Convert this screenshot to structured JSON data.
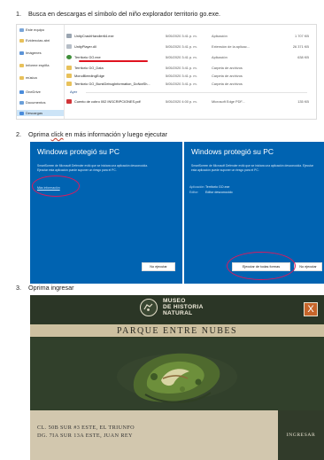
{
  "steps": [
    {
      "num": "1.",
      "text": "Busca en descargas el símbolo del niño explorador territorio go.exe."
    },
    {
      "num": "2.",
      "text_before": "Oprima ",
      "text_wavy": "click",
      "text_after": " en más información y luego ejecutar"
    },
    {
      "num": "3.",
      "text": "Oprima ingresar"
    }
  ],
  "explorer": {
    "nav": [
      {
        "label": "Este equipo",
        "color": "#7aa6d8"
      },
      {
        "label": "Evidencias abri",
        "color": "#e8c15a"
      },
      {
        "label": "Imágenes",
        "color": "#5c93d6"
      },
      {
        "label": "Informe espiña",
        "color": "#e8c15a"
      },
      {
        "label": "música",
        "color": "#e8c15a"
      },
      {
        "label": "OneDrive",
        "color": "#4a8cdb"
      },
      {
        "label": "Documentos",
        "color": "#6b9fd8"
      },
      {
        "label": "Descargas",
        "color": "#4a8cdb"
      }
    ],
    "files": [
      {
        "name": "UnityCrashHandler64.exe",
        "date": "5/05/2020 3:41 p. m.",
        "type": "Aplicación",
        "size": "1 707 KB",
        "color": "#9aa5b1"
      },
      {
        "name": "UnityPlayer.dll",
        "date": "5/05/2020 3:41 p. m.",
        "type": "Extensión de la aplicac...",
        "size": "26 371 KB",
        "color": "#b6bec7"
      },
      {
        "name": "Territorio GO.exe",
        "date": "5/05/2020 3:41 p. m.",
        "type": "Aplicación",
        "size": "638 KB",
        "color": "#3f8f3a"
      },
      {
        "name": "Territorio GO_Data",
        "date": "5/05/2020 3:41 p. m.",
        "type": "Carpeta de archivos",
        "size": "",
        "color": "#e8c15a"
      },
      {
        "name": "MonoBleedingEdge",
        "date": "5/05/2020 3:41 p. m.",
        "type": "Carpeta de archivos",
        "size": "",
        "color": "#e8c15a"
      },
      {
        "name": "Territorio GO_BurstDebugInformation_DoNotSh...",
        "date": "5/05/2020 3:41 p. m.",
        "type": "Carpeta de archivos",
        "size": "",
        "color": "#e8c15a"
      },
      {
        "name": "Cuento de cobro 002 INSCRIPCIONES.pdf",
        "date": "5/05/2020 4:00 p. m.",
        "type": "Microsoft Edge PDF...",
        "size": "135 KB",
        "color": "#d13438"
      }
    ],
    "group_label": "Ayer"
  },
  "smartscreen_left": {
    "title": "Windows protegió su PC",
    "body": "SmartScreen de Microsoft Defender evitó que se iniciara una aplicación desconocida. Ejecutar esta aplicación puede suponer un riesgo para el PC.",
    "link": "Más información",
    "button": "No ejecutar"
  },
  "smartscreen_right": {
    "title": "Windows protegió su PC",
    "body": "SmartScreen de Microsoft Defender evitó que se iniciara una aplicación desconocida. Ejecutar esta aplicación puede suponer un riesgo para el PC.",
    "app_label": "Aplicación:",
    "app_value": "Territorio GO.exe",
    "publisher_label": "Editor:",
    "publisher_value": "Editor desconocido",
    "run_button": "Ejecutar de todas formas",
    "cancel_button": "No ejecutar"
  },
  "museum": {
    "logo_lines": [
      "MUSEO",
      "DE HISTORIA",
      "NATURAL"
    ],
    "close_label": "X",
    "banner": "PARQUE ENTRE NUBES",
    "address_lines": [
      "CL. 50B SUR #3 ESTE, EL TRIUNFO",
      "DG. 7IA SUR 13A ESTE, JUAN REY"
    ],
    "enter_button": "INGRESAR"
  },
  "colors": {
    "smartscreen_blue": "#0063b1",
    "highlight_ellipse": "#d81b60",
    "museum_dark": "#31402b",
    "museum_sand": "#d2c7ae",
    "close_orange": "#c6652a"
  }
}
